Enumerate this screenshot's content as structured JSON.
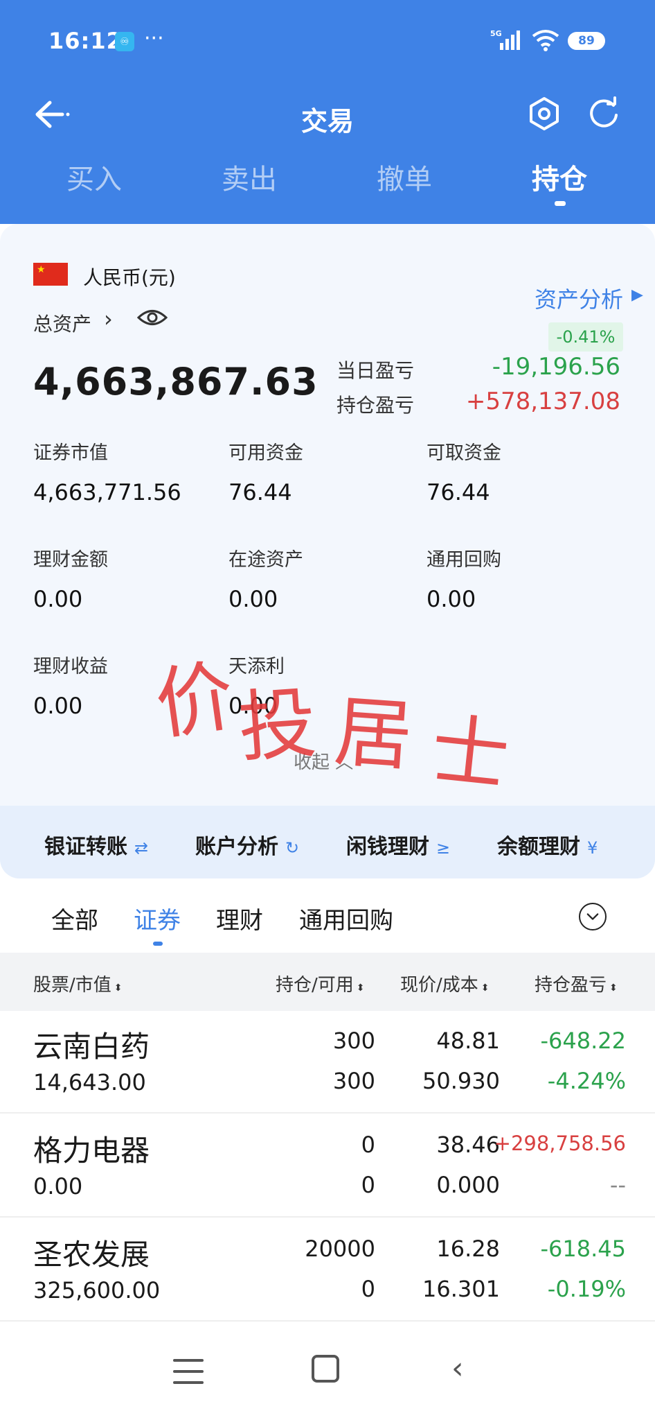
{
  "status_bar": {
    "time": "16:12",
    "app_icon": "♾",
    "more": "···",
    "network": "5G",
    "battery": "89"
  },
  "nav": {
    "title": "交易"
  },
  "trade_tabs": [
    "买入",
    "卖出",
    "撤单",
    "持仓"
  ],
  "account": {
    "currency": "人民币(元)",
    "asset_analysis_label": "资产分析",
    "total_asset_label": "总资产",
    "total_asset_value": "4,663,867.63",
    "day_pct": "-0.41%",
    "day_pl_label": "当日盈亏",
    "day_pl_value": "-19,196.56",
    "hold_pl_label": "持仓盈亏",
    "hold_pl_value": "+578,137.08",
    "metrics": [
      {
        "label": "证券市值",
        "value": "4,663,771.56"
      },
      {
        "label": "可用资金",
        "value": "76.44"
      },
      {
        "label": "可取资金",
        "value": "76.44"
      },
      {
        "label": "理财金额",
        "value": "0.00"
      },
      {
        "label": "在途资产",
        "value": "0.00"
      },
      {
        "label": "通用回购",
        "value": "0.00"
      },
      {
        "label": "理财收益",
        "value": "0.00"
      },
      {
        "label": "天添利",
        "value": "0.00"
      }
    ],
    "collapse_label": "收起"
  },
  "watermark": [
    "价",
    "投",
    "居",
    "士"
  ],
  "quick_links": [
    {
      "label": "银证转账",
      "icon": "⇄"
    },
    {
      "label": "账户分析",
      "icon": "↻"
    },
    {
      "label": "闲钱理财",
      "icon": "≥"
    },
    {
      "label": "余额理财",
      "icon": "¥"
    }
  ],
  "holdings_tabs": [
    "全部",
    "证券",
    "理财",
    "通用回购"
  ],
  "table": {
    "headers": [
      "股票/市值",
      "持仓/可用",
      "现价/成本",
      "持仓盈亏"
    ],
    "rows": [
      {
        "name": "云南白药",
        "market_value": "14,643.00",
        "position": "300",
        "available": "300",
        "price": "48.81",
        "cost": "50.930",
        "pl": "-648.22",
        "pl_pct": "-4.24%"
      },
      {
        "name": "格力电器",
        "market_value": "0.00",
        "position": "0",
        "available": "0",
        "price": "38.46",
        "cost": "0.000",
        "pl": "+298,758.56",
        "pl_pct": "--"
      },
      {
        "name": "圣农发展",
        "market_value": "325,600.00",
        "position": "20000",
        "available": "0",
        "price": "16.28",
        "cost": "16.301",
        "pl": "-618.45",
        "pl_pct": "-0.19%"
      }
    ]
  },
  "colors": {
    "brand_blue": "#3f82e6",
    "gain_red": "#d84040",
    "loss_green": "#2ba24c"
  }
}
